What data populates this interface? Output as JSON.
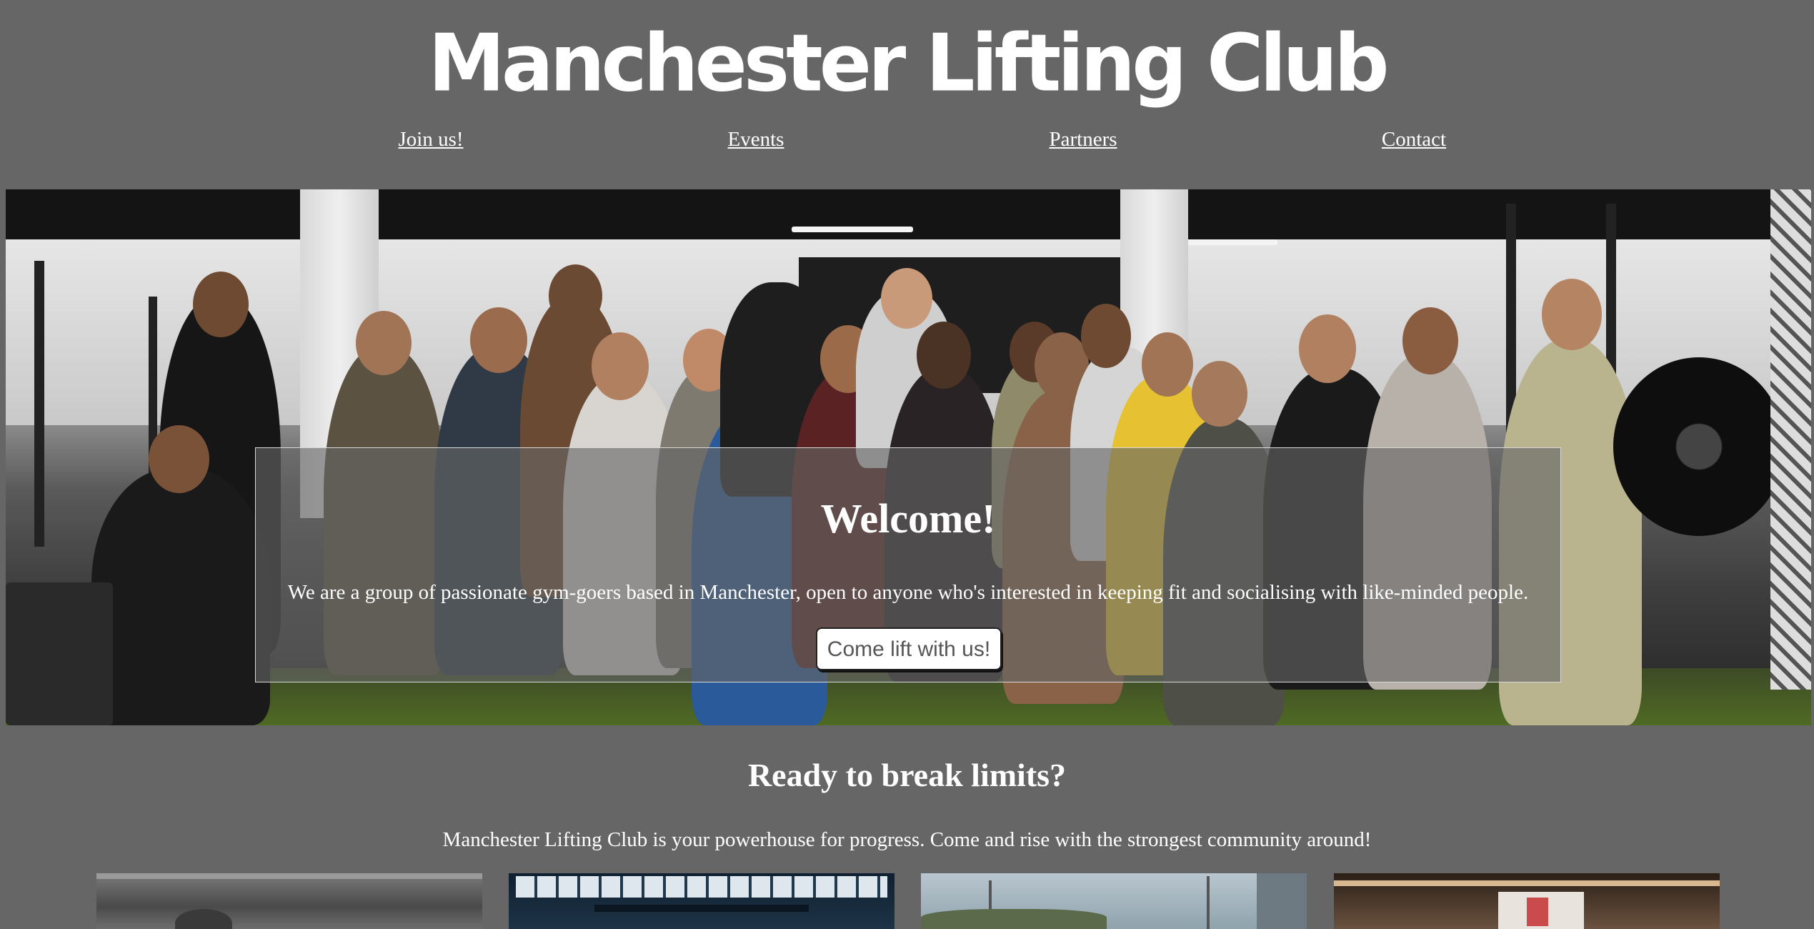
{
  "header": {
    "title": "Manchester Lifting Club"
  },
  "nav": {
    "items": [
      {
        "label": "Join us!"
      },
      {
        "label": "Events"
      },
      {
        "label": "Partners"
      },
      {
        "label": "Contact"
      }
    ]
  },
  "hero": {
    "image_description_icon": "group-photo-image",
    "welcome_title": "Welcome!",
    "welcome_text": "We are a group of passionate gym-goers based in Manchester, open to anyone who's interested in keeping fit and socialising with like-minded people.",
    "cta_label": "Come lift with us!"
  },
  "intro": {
    "title": "Ready to break limits?",
    "text": "Manchester Lifting Club is your powerhouse for progress. Come and rise with the strongest community around!"
  },
  "colors": {
    "background": "#666666",
    "text": "#ffffff",
    "button_bg": "#ffffff",
    "button_text": "#555555"
  }
}
